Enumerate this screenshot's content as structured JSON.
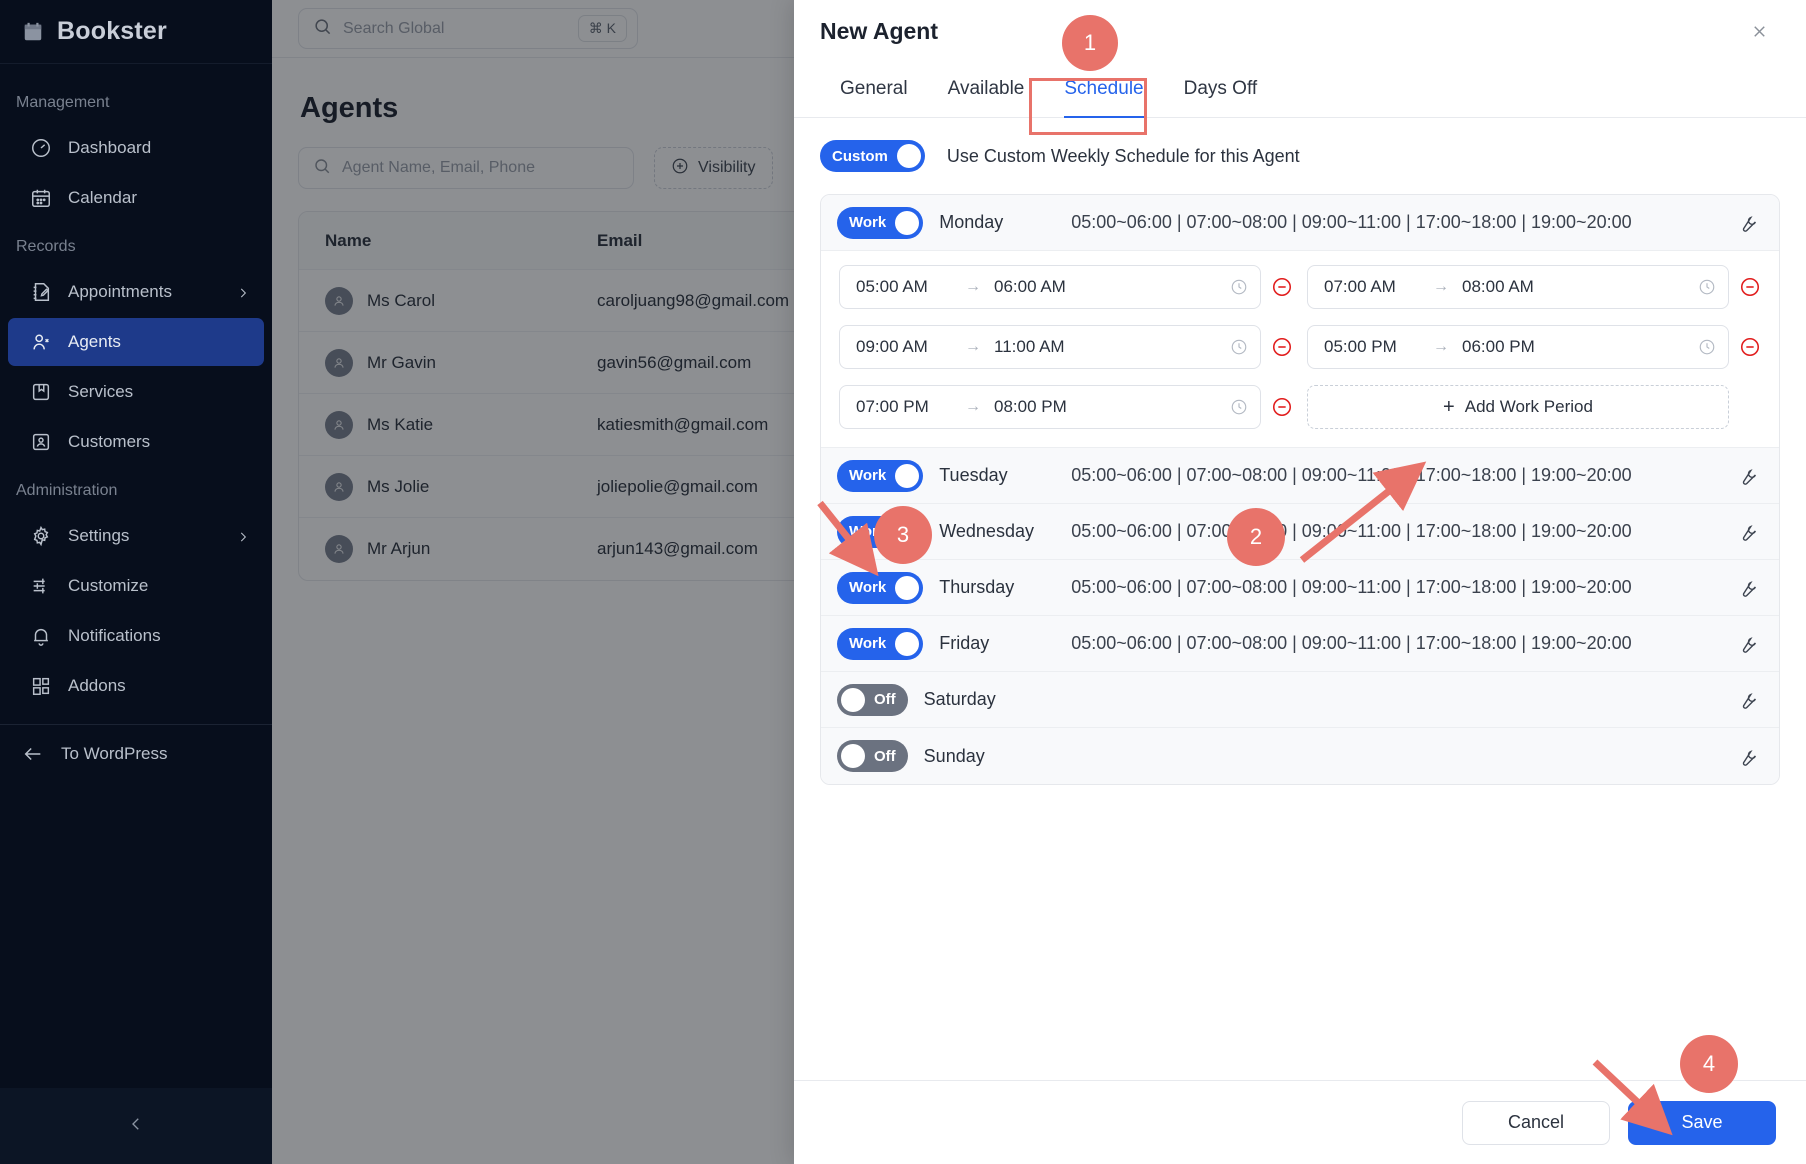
{
  "sidebar": {
    "brand": "Bookster",
    "brand_icon": "calendar-icon",
    "sections": [
      {
        "label": "Management",
        "items": [
          {
            "label": "Dashboard",
            "icon": "gauge-icon",
            "active": false,
            "chevron": false
          },
          {
            "label": "Calendar",
            "icon": "calendar-icon",
            "active": false,
            "chevron": false
          }
        ]
      },
      {
        "label": "Records",
        "items": [
          {
            "label": "Appointments",
            "icon": "notebook-pen-icon",
            "active": false,
            "chevron": true
          },
          {
            "label": "Agents",
            "icon": "user-icon",
            "active": true,
            "chevron": false
          },
          {
            "label": "Services",
            "icon": "package-icon",
            "active": false,
            "chevron": false
          },
          {
            "label": "Customers",
            "icon": "contact-card-icon",
            "active": false,
            "chevron": false
          }
        ]
      },
      {
        "label": "Administration",
        "items": [
          {
            "label": "Settings",
            "icon": "gear-icon",
            "active": false,
            "chevron": true
          },
          {
            "label": "Customize",
            "icon": "sliders-icon",
            "active": false,
            "chevron": false
          },
          {
            "label": "Notifications",
            "icon": "bell-icon",
            "active": false,
            "chevron": false
          },
          {
            "label": "Addons",
            "icon": "blocks-icon",
            "active": false,
            "chevron": false
          }
        ]
      }
    ],
    "to_wordpress": "To WordPress",
    "collapse_icon": "chevron-left-icon"
  },
  "topbar": {
    "search_placeholder": "Search Global",
    "search_value": "",
    "shortcut": "⌘ K"
  },
  "page": {
    "title": "Agents",
    "filter_placeholder": "Agent Name, Email, Phone",
    "visibility_button": "Visibility",
    "table": {
      "columns": [
        "Name",
        "Email"
      ],
      "rows": [
        {
          "name": "Ms Carol",
          "email": "caroljuang98@gmail.com"
        },
        {
          "name": "Mr Gavin",
          "email": "gavin56@gmail.com"
        },
        {
          "name": "Ms Katie",
          "email": "katiesmith@gmail.com"
        },
        {
          "name": "Ms Jolie",
          "email": "joliepolie@gmail.com"
        },
        {
          "name": "Mr Arjun",
          "email": "arjun143@gmail.com"
        }
      ]
    }
  },
  "modal": {
    "title": "New Agent",
    "close_icon": "close-icon",
    "tabs": [
      {
        "label": "General",
        "active": false
      },
      {
        "label": "Available",
        "active": false
      },
      {
        "label": "Schedule",
        "active": true
      },
      {
        "label": "Days Off",
        "active": false
      }
    ],
    "custom_toggle": {
      "label": "Custom",
      "state": "on"
    },
    "custom_description": "Use Custom Weekly Schedule for this Agent",
    "schedule_summary": "05:00~06:00 | 07:00~08:00 | 09:00~11:00 | 17:00~18:00 | 19:00~20:00",
    "days": [
      {
        "name": "Monday",
        "toggle_label": "Work",
        "state": "on",
        "expanded": true
      },
      {
        "name": "Tuesday",
        "toggle_label": "Work",
        "state": "on",
        "expanded": false
      },
      {
        "name": "Wednesday",
        "toggle_label": "Work",
        "state": "on",
        "expanded": false
      },
      {
        "name": "Thursday",
        "toggle_label": "Work",
        "state": "on",
        "expanded": false
      },
      {
        "name": "Friday",
        "toggle_label": "Work",
        "state": "on",
        "expanded": false
      },
      {
        "name": "Saturday",
        "toggle_label": "Off",
        "state": "off",
        "expanded": false,
        "summary": ""
      },
      {
        "name": "Sunday",
        "toggle_label": "Off",
        "state": "off",
        "expanded": false,
        "summary": ""
      }
    ],
    "periods": [
      {
        "from": "05:00 AM",
        "to": "06:00 AM"
      },
      {
        "from": "07:00 AM",
        "to": "08:00 AM"
      },
      {
        "from": "09:00 AM",
        "to": "11:00 AM"
      },
      {
        "from": "05:00 PM",
        "to": "06:00 PM"
      },
      {
        "from": "07:00 PM",
        "to": "08:00 PM"
      }
    ],
    "add_period_label": "Add Work Period",
    "add_period_plus": "+",
    "arrow_glyph": "→",
    "footer": {
      "cancel": "Cancel",
      "save": "Save"
    }
  },
  "annotations": {
    "accent_color": "#e8736a",
    "badges": [
      {
        "num": "1"
      },
      {
        "num": "2"
      },
      {
        "num": "3"
      },
      {
        "num": "4"
      }
    ]
  }
}
